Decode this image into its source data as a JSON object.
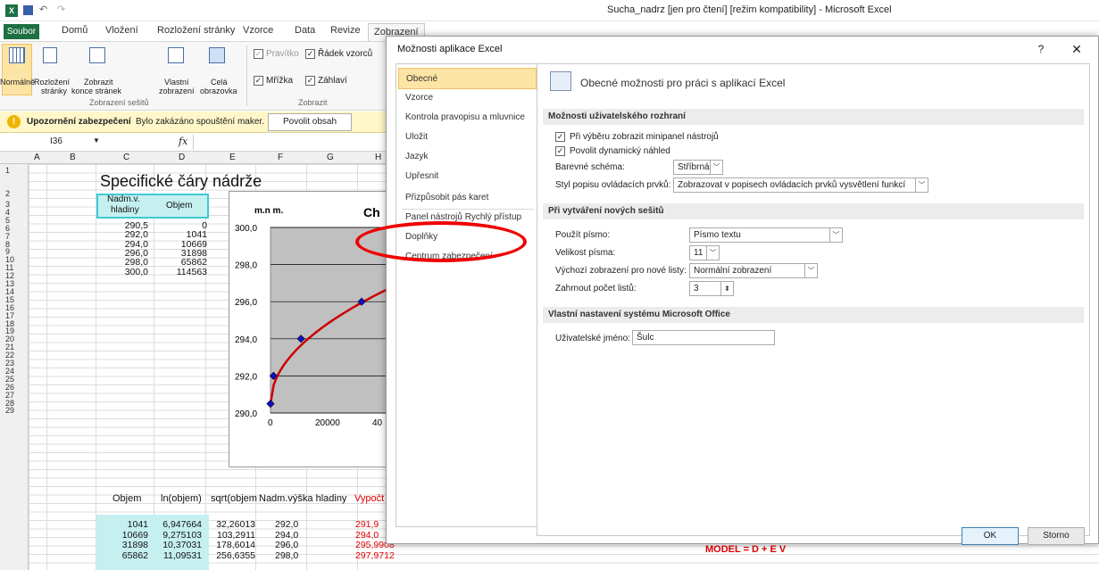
{
  "window_title": "Sucha_nadrz  [jen pro čtení]  [režim kompatibility]  -  Microsoft Excel",
  "ribbon_tabs": [
    "Soubor",
    "Domů",
    "Vložení",
    "Rozložení stránky",
    "Vzorce",
    "Data",
    "Revize",
    "Zobrazení"
  ],
  "ribbon": {
    "btn_normal": "Normálně",
    "btn_layout_1": "Rozložení",
    "btn_layout_2": "stránky",
    "btn_breaks_1": "Zobrazit",
    "btn_breaks_2": "konce stránek",
    "btn_custom_1": "Vlastní",
    "btn_custom_2": "zobrazení",
    "btn_full_1": "Celá",
    "btn_full_2": "obrazovka",
    "group_views": "Zobrazení sešitů",
    "cb_ruler": "Pravítko",
    "cb_formula_bar": "Řádek vzorců",
    "cb_gridlines": "Mřížka",
    "cb_headings": "Záhlaví",
    "group_show": "Zobrazit"
  },
  "security_bar": {
    "title": "Upozornění zabezpečení",
    "message": "Bylo zakázáno spouštění maker.",
    "button": "Povolit obsah"
  },
  "formula_bar": {
    "name_box": "I36",
    "fx": "fx"
  },
  "columns": [
    "A",
    "B",
    "C",
    "D",
    "E",
    "F",
    "G",
    "H"
  ],
  "rows": [
    "1",
    "2",
    "3",
    "4",
    "5",
    "6",
    "7",
    "8",
    "9",
    "10",
    "11",
    "12",
    "13",
    "14",
    "15",
    "16",
    "17",
    "18",
    "19",
    "20",
    "21",
    "22",
    "23",
    "24",
    "25",
    "26",
    "27",
    "28",
    "29"
  ],
  "sheet": {
    "title": "Specifické čáry nádrže",
    "hdr_c_1": "Nadm.v.",
    "hdr_c_2": "hladiny",
    "hdr_d": "Objem",
    "table1": [
      [
        "290,5",
        "0"
      ],
      [
        "292,0",
        "1041"
      ],
      [
        "294,0",
        "10669"
      ],
      [
        "296,0",
        "31898"
      ],
      [
        "298,0",
        "65862"
      ],
      [
        "300,0",
        "114563"
      ]
    ],
    "lower_headers": [
      "Objem",
      "ln(objem)",
      "sqrt(objem",
      "Nadm.výška hladiny",
      "Vypočt"
    ],
    "table2": [
      [
        "1041",
        "6,947664",
        "32,26013",
        "292,0",
        "291,9"
      ],
      [
        "10669",
        "9,275103",
        "103,2911",
        "294,0",
        "294,0"
      ],
      [
        "31898",
        "10,37031",
        "178,6014",
        "296,0",
        "295,9908"
      ],
      [
        "65862",
        "11,09531",
        "256,6355",
        "298,0",
        "297,9712"
      ]
    ],
    "model_text": "MODEL = D + E V"
  },
  "chart_data": {
    "type": "scatter",
    "title": "Ch",
    "ylabel": "m.n m.",
    "x": [
      0,
      1041,
      10669,
      31898
    ],
    "y": [
      290.5,
      292.0,
      294.0,
      296.0
    ],
    "y_ticks": [
      "300,0",
      "298,0",
      "296,0",
      "294,0",
      "292,0",
      "290,0"
    ],
    "x_ticks": [
      "0",
      "20000",
      "40"
    ],
    "ylim": [
      290,
      300
    ],
    "colors": {
      "fit": "#cc0000",
      "points": "#1010c0",
      "plot_bg": "#c0c0c0"
    }
  },
  "dialog": {
    "title": "Možnosti aplikace Excel",
    "help": "?",
    "close": "✕",
    "nav": [
      "Obecné",
      "Vzorce",
      "Kontrola pravopisu a mluvnice",
      "Uložit",
      "Jazyk",
      "Upřesnit",
      "Přizpůsobit pás karet",
      "Panel nástrojů Rychlý přístup",
      "Doplňky",
      "Centrum zabezpečení"
    ],
    "header": "Obecné možnosti pro práci s aplikací Excel",
    "sec_ui": "Možnosti uživatelského rozhraní",
    "cb_minitoolbar": "Při výběru zobrazit minipanel nástrojů",
    "cb_live_preview": "Povolit dynamický náhled",
    "color_scheme_label": "Barevné schéma:",
    "color_scheme_value": "Stříbrná",
    "tooltip_style_label": "Styl popisu ovládacích prvků:",
    "tooltip_style_value": "Zobrazovat v popisech ovládacích prvků vysvětlení funkcí",
    "sec_new": "Při vytváření nových sešitů",
    "font_label": "Použít písmo:",
    "font_value": "Písmo textu",
    "size_label": "Velikost písma:",
    "size_value": "11",
    "view_label": "Výchozí zobrazení pro nové listy:",
    "view_value": "Normální zobrazení",
    "sheets_label": "Zahrnout počet listů:",
    "sheets_value": "3",
    "sec_office": "Vlastní nastavení systému Microsoft Office",
    "username_label": "Uživatelské jméno:",
    "username_value": "Šulc",
    "ok": "OK",
    "cancel": "Storno"
  }
}
